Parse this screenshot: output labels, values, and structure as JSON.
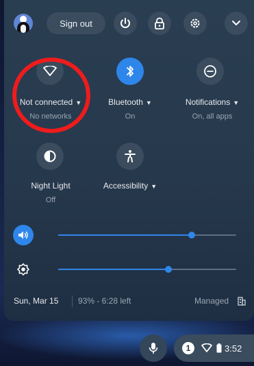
{
  "header": {
    "sign_out_label": "Sign out",
    "icons": [
      "avatar",
      "power-icon",
      "lock-icon",
      "gear-icon",
      "chevron-down-icon"
    ]
  },
  "tiles": [
    {
      "label": "Not connected",
      "sublabel": "No networks",
      "icon": "wifi-icon",
      "active": false,
      "has_menu": true
    },
    {
      "label": "Bluetooth",
      "sublabel": "On",
      "icon": "bluetooth-icon",
      "active": true,
      "has_menu": true
    },
    {
      "label": "Notifications",
      "sublabel": "On, all apps",
      "icon": "notifications-icon",
      "active": false,
      "has_menu": true
    },
    {
      "label": "Night Light",
      "sublabel": "Off",
      "icon": "night-light-icon",
      "active": false,
      "has_menu": false
    },
    {
      "label": "Accessibility",
      "sublabel": "",
      "icon": "accessibility-icon",
      "active": false,
      "has_menu": true
    }
  ],
  "sliders": {
    "volume": {
      "icon": "volume-icon",
      "level_percent": 75
    },
    "brightness": {
      "icon": "brightness-icon",
      "level_percent": 62
    }
  },
  "footer": {
    "date": "Sun, Mar 15",
    "battery": "93% - 6:28 left",
    "managed": "Managed"
  },
  "shelf": {
    "mic_icon": "microphone-icon",
    "notification_count": "1",
    "time": "3:52"
  },
  "colors": {
    "accent": "#2f86ea",
    "panel": "#26384c",
    "highlight_ring": "#ee1c1c"
  }
}
